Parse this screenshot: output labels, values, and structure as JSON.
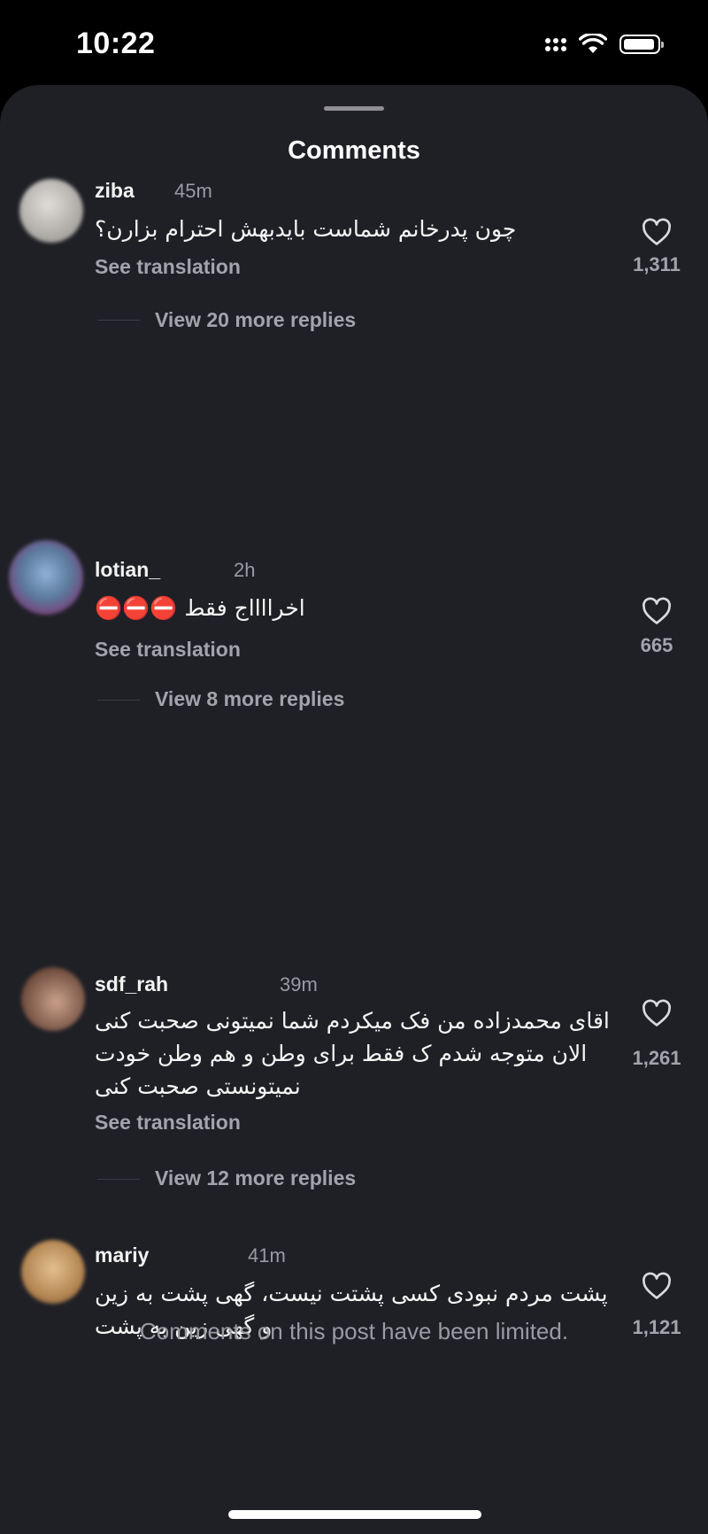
{
  "status_bar": {
    "time": "10:22"
  },
  "sheet": {
    "title": "Comments"
  },
  "comments": [
    {
      "username": "ziba",
      "time": "45m",
      "text": "چون پدرخانم شماست بایدبهش احترام بزارن؟",
      "see_translation": "See translation",
      "view_replies": "View 20 more replies",
      "likes": "1,311",
      "avatar_color": "#b9b7b2"
    },
    {
      "username": "lotian_",
      "time": "2h",
      "text": "اخرااااج فقط ⛔⛔⛔",
      "see_translation": "See translation",
      "view_replies": "View 8 more replies",
      "likes": "665",
      "avatar_color": "#6e8fb0"
    },
    {
      "username": "sdf_rah",
      "time": "39m",
      "text": "اقای محمدزاده من فک میکردم شما نمیتونی صحبت کنی الان متوجه شدم ک فقط برای وطن و هم وطن خودت نمیتونستی صحبت کنی",
      "see_translation": "See translation",
      "view_replies": "View 12 more replies",
      "likes": "1,261",
      "avatar_color": "#8a6a5a"
    },
    {
      "username": "mariy",
      "time": "41m",
      "text": "پشت مردم نبودی کسی پشتت نیست، گهی پشت به زین و گهی زین به پشت",
      "likes": "1,121",
      "avatar_color": "#c8a070"
    }
  ],
  "footer": {
    "limited_note": "Comments on this post have been limited."
  }
}
